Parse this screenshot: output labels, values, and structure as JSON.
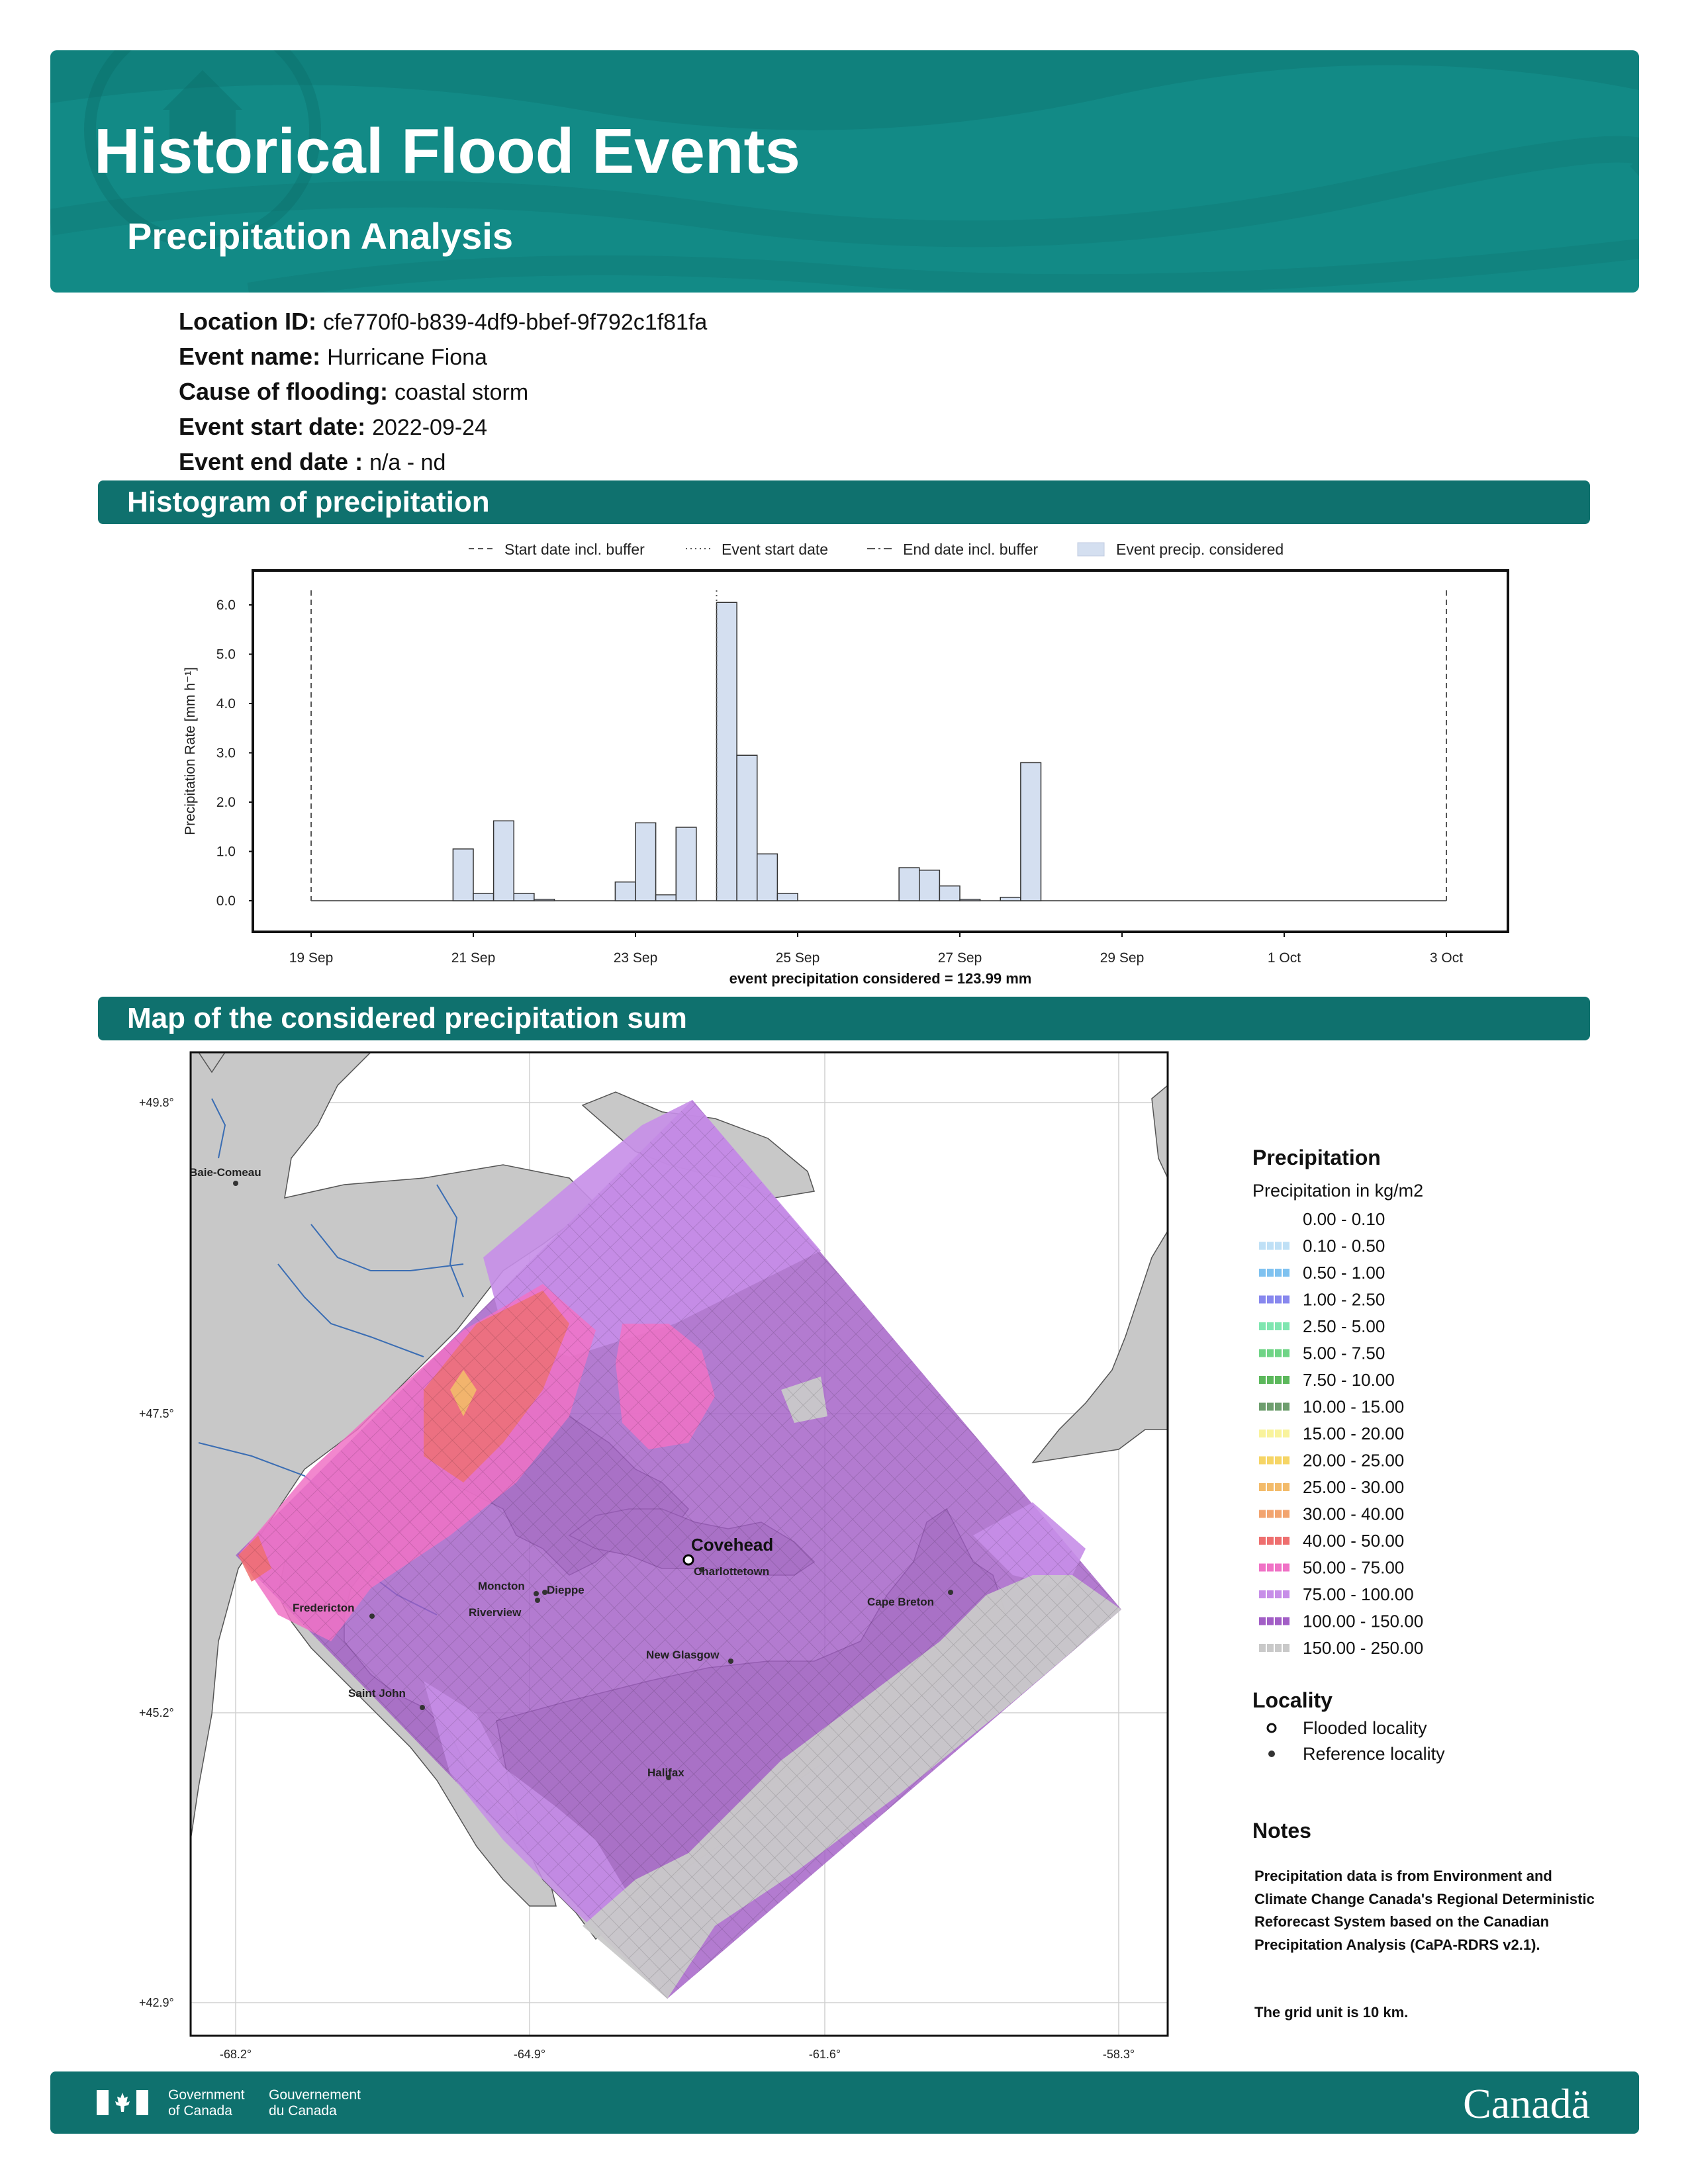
{
  "header": {
    "title": "Historical Flood Events",
    "subtitle": "Precipitation Analysis"
  },
  "event": {
    "location_id_label": "Location ID:",
    "location_id": "cfe770f0-b839-4df9-bbef-9f792c1f81fa",
    "event_name_label": "Event name:",
    "event_name": "Hurricane Fiona",
    "cause_label": "Cause of flooding:",
    "cause": "coastal storm",
    "start_label": "Event start date:",
    "start": "2022-09-24",
    "end_label": "Event end date :",
    "end": "n/a - nd"
  },
  "sections": {
    "histogram": "Histogram of precipitation",
    "map": "Map of the considered precipitation sum"
  },
  "chart_data": {
    "type": "bar",
    "ylabel": "Precipitation Rate [mm h⁻¹]",
    "ylim": [
      0,
      6.0
    ],
    "yticks": [
      "0.0",
      "1.0",
      "2.0",
      "3.0",
      "4.0",
      "5.0",
      "6.0"
    ],
    "xticks": [
      "19 Sep",
      "21 Sep",
      "23 Sep",
      "25 Sep",
      "27 Sep",
      "29 Sep",
      "1 Oct",
      "3 Oct"
    ],
    "x_tick_days": [
      19,
      21,
      23,
      25,
      27,
      29,
      31,
      33
    ],
    "legend": [
      "Start date incl. buffer",
      "Event start date",
      "End date incl. buffer",
      "Event precip. considered"
    ],
    "legend_position": "top",
    "lines": {
      "start_buffer_day": 19,
      "event_start_day": 24,
      "end_buffer_day": 33
    },
    "bin_width_days": 0.25,
    "bars": [
      {
        "start_day": 20.75,
        "value": 1.05
      },
      {
        "start_day": 21.0,
        "value": 0.15
      },
      {
        "start_day": 21.25,
        "value": 1.62
      },
      {
        "start_day": 21.5,
        "value": 0.15
      },
      {
        "start_day": 21.75,
        "value": 0.03
      },
      {
        "start_day": 22.75,
        "value": 0.38
      },
      {
        "start_day": 23.0,
        "value": 1.58
      },
      {
        "start_day": 23.25,
        "value": 0.12
      },
      {
        "start_day": 23.5,
        "value": 1.49
      },
      {
        "start_day": 24.0,
        "value": 6.05
      },
      {
        "start_day": 24.25,
        "value": 2.95
      },
      {
        "start_day": 24.5,
        "value": 0.95
      },
      {
        "start_day": 24.75,
        "value": 0.15
      },
      {
        "start_day": 26.25,
        "value": 0.67
      },
      {
        "start_day": 26.5,
        "value": 0.62
      },
      {
        "start_day": 26.75,
        "value": 0.3
      },
      {
        "start_day": 27.0,
        "value": 0.03
      },
      {
        "start_day": 27.5,
        "value": 0.07
      },
      {
        "start_day": 27.75,
        "value": 2.8
      }
    ],
    "annotation": "event precipitation considered = 123.99 mm"
  },
  "map": {
    "lat_labels": [
      "+49.8°",
      "+47.5°",
      "+45.2°",
      "+42.9°"
    ],
    "lon_labels": [
      "-68.2°",
      "-64.9°",
      "-61.6°",
      "-58.3°"
    ],
    "places": {
      "covehead": "Covehead",
      "baie_comeau": "Baie-Comeau",
      "charlottetown": "Charlottetown",
      "moncton": "Moncton",
      "dieppe": "Dieppe",
      "riverview": "Riverview",
      "fredericton": "Fredericton",
      "cape_breton": "Cape Breton",
      "new_glasgow": "New Glasgow",
      "saint_john": "Saint John",
      "halifax": "Halifax"
    },
    "legend_title": "Precipitation",
    "legend_subtitle": "Precipitation in kg/m2",
    "classes": [
      {
        "label": "0.00 - 0.10",
        "color": "#ffffff"
      },
      {
        "label": "0.10 - 0.50",
        "color": "#bfe0f6"
      },
      {
        "label": "0.50 - 1.00",
        "color": "#7fc2f0"
      },
      {
        "label": "1.00 - 2.50",
        "color": "#8888ee"
      },
      {
        "label": "2.50 - 5.00",
        "color": "#7fe6b0"
      },
      {
        "label": "5.00 - 7.50",
        "color": "#6fd486"
      },
      {
        "label": "7.50 - 10.00",
        "color": "#5cb85c"
      },
      {
        "label": "10.00 - 15.00",
        "color": "#6e9e6e"
      },
      {
        "label": "15.00 - 20.00",
        "color": "#f9f39c"
      },
      {
        "label": "20.00 - 25.00",
        "color": "#f6d566"
      },
      {
        "label": "25.00 - 30.00",
        "color": "#f3bb6a"
      },
      {
        "label": "30.00 - 40.00",
        "color": "#f2a46f"
      },
      {
        "label": "40.00 - 50.00",
        "color": "#ee6f6f"
      },
      {
        "label": "50.00 - 75.00",
        "color": "#f072c6"
      },
      {
        "label": "75.00 - 100.00",
        "color": "#c78ee8"
      },
      {
        "label": "100.00 - 150.00",
        "color": "#a25ec6"
      },
      {
        "label": "150.00 - 250.00",
        "color": "#c9c9c9"
      }
    ],
    "locality_title": "Locality",
    "locality_flooded": "Flooded locality",
    "locality_reference": "Reference locality",
    "notes_title": "Notes",
    "notes_text": "Precipitation data is from Environment and Climate Change Canada's Regional Deterministic Reforecast System based on the Canadian Precipitation Analysis (CaPA-RDRS v2.1).",
    "notes_grid": "The grid unit is 10 km."
  },
  "footer": {
    "gov_en_1": "Government",
    "gov_en_2": "of Canada",
    "gov_fr_1": "Gouvernement",
    "gov_fr_2": "du Canada",
    "wordmark": "Canadä"
  }
}
